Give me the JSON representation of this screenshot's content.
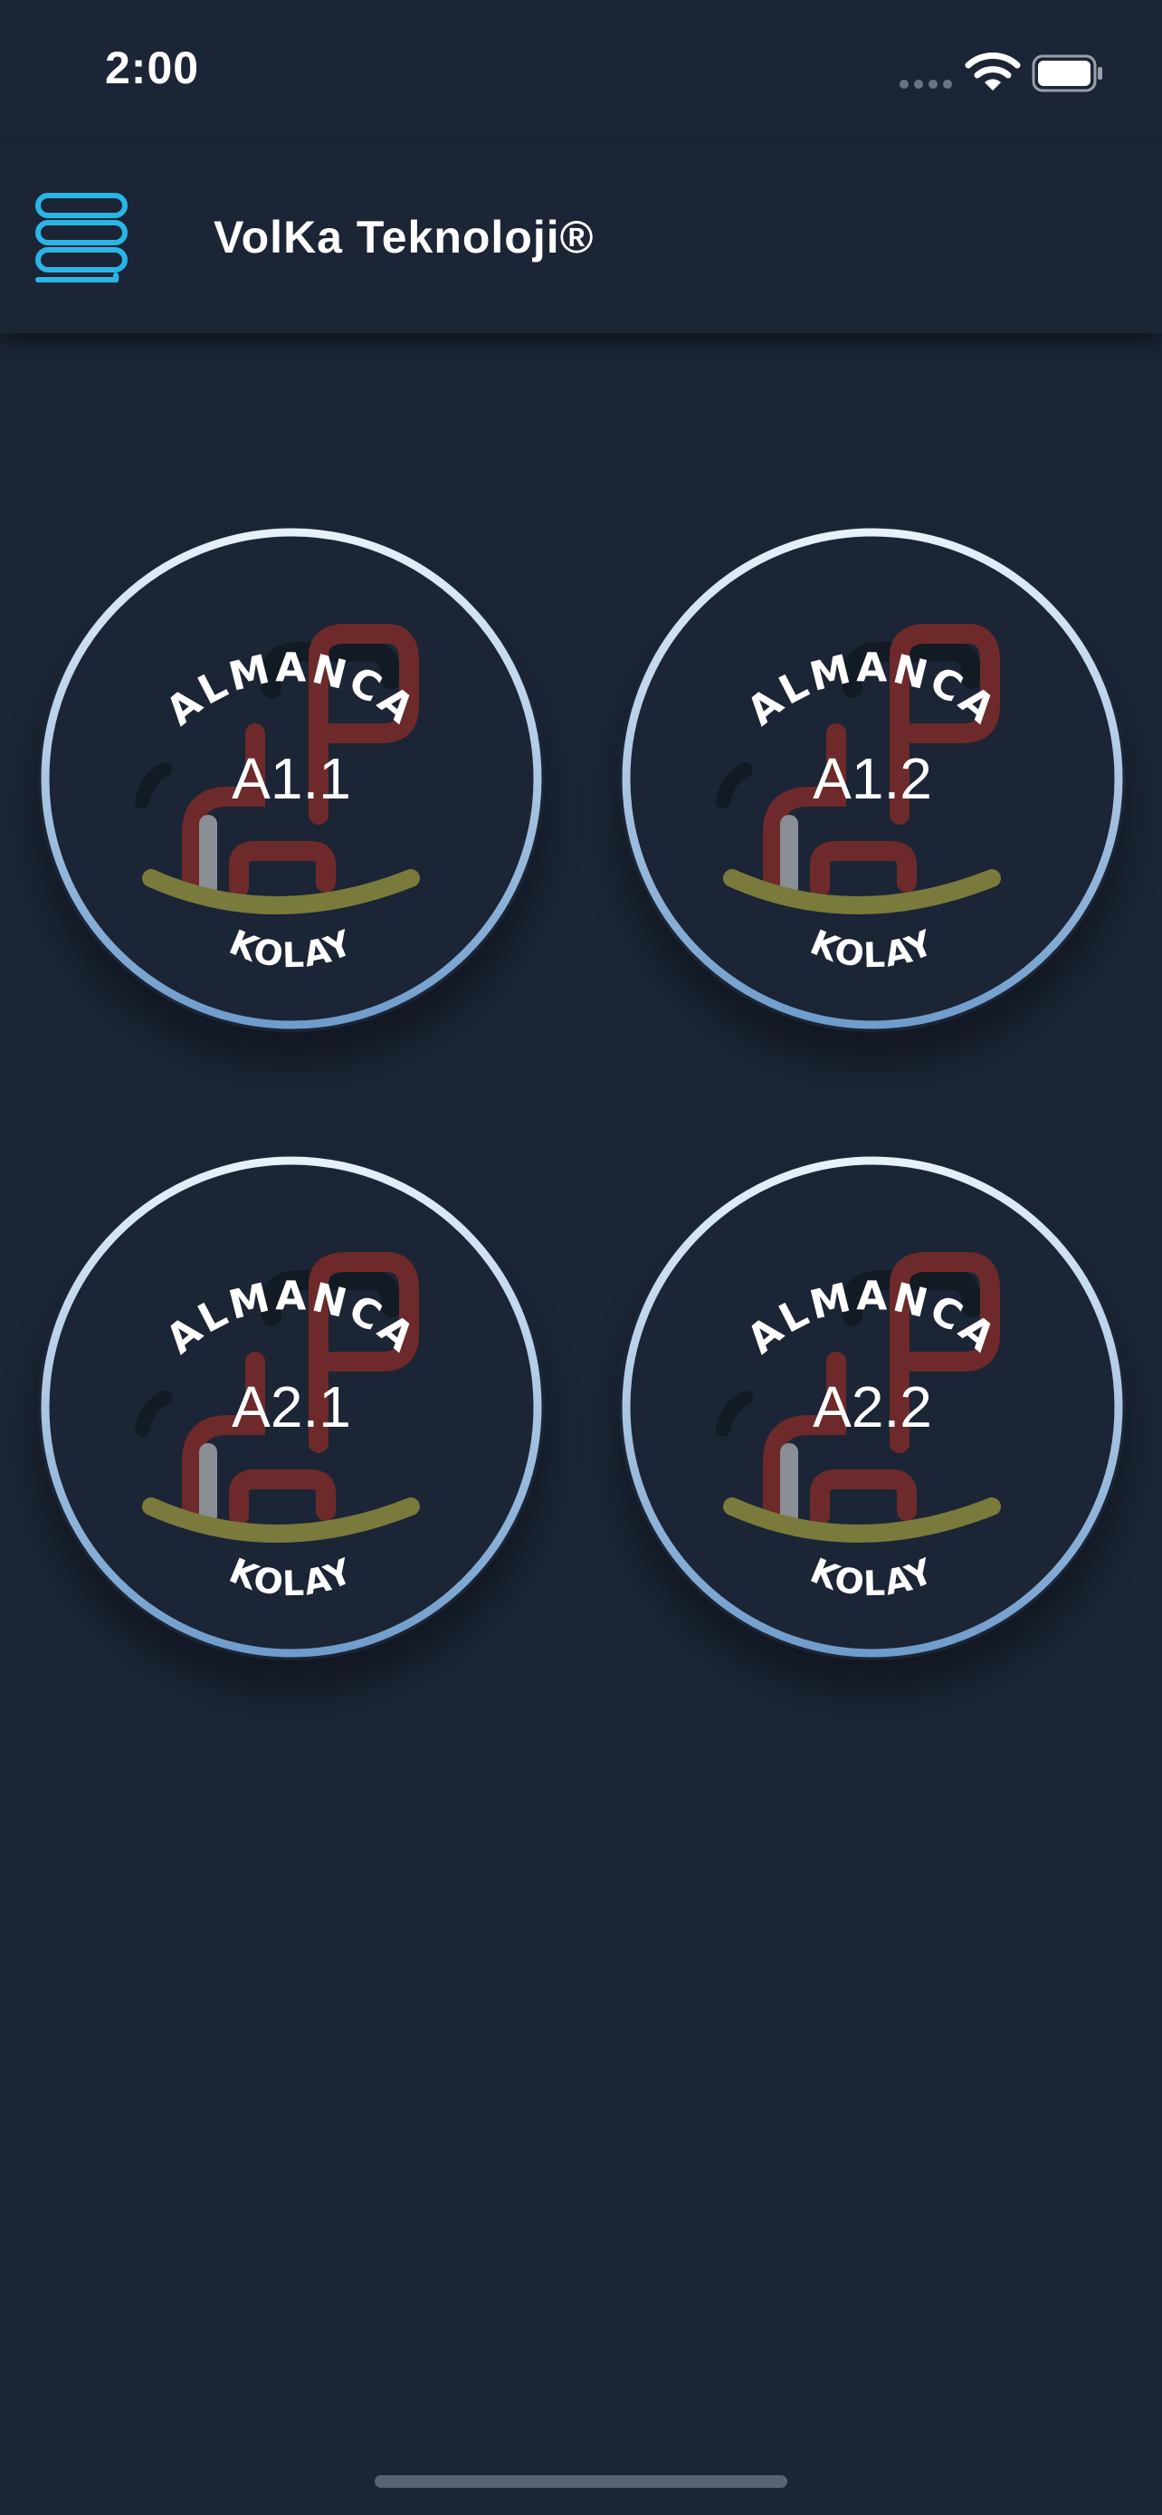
{
  "status_bar": {
    "time": "2:00",
    "icons": [
      "signal-icon",
      "wifi-icon",
      "battery-icon"
    ]
  },
  "app_bar": {
    "menu_icon": "menu-icon",
    "title": "VolKa Teknoloji®"
  },
  "courses": [
    {
      "label": "A1.1",
      "badge_top": "ALMANCA",
      "badge_bottom": "KOLAY"
    },
    {
      "label": "A1.2",
      "badge_top": "ALMANCA",
      "badge_bottom": "KOLAY"
    },
    {
      "label": "A2.1",
      "badge_top": "ALMANCA",
      "badge_bottom": "KOLAY"
    },
    {
      "label": "A2.2",
      "badge_top": "ALMANCA",
      "badge_bottom": "KOLAY"
    }
  ],
  "colors": {
    "background": "#1b2535",
    "badge_ring_light": "#e6f1fb",
    "badge_ring_dark": "#6f9ccc",
    "horse_body": "#6e2a2a",
    "horse_rocker": "#7a7a3c",
    "menu_icon_cyan": "#29b6e6"
  }
}
